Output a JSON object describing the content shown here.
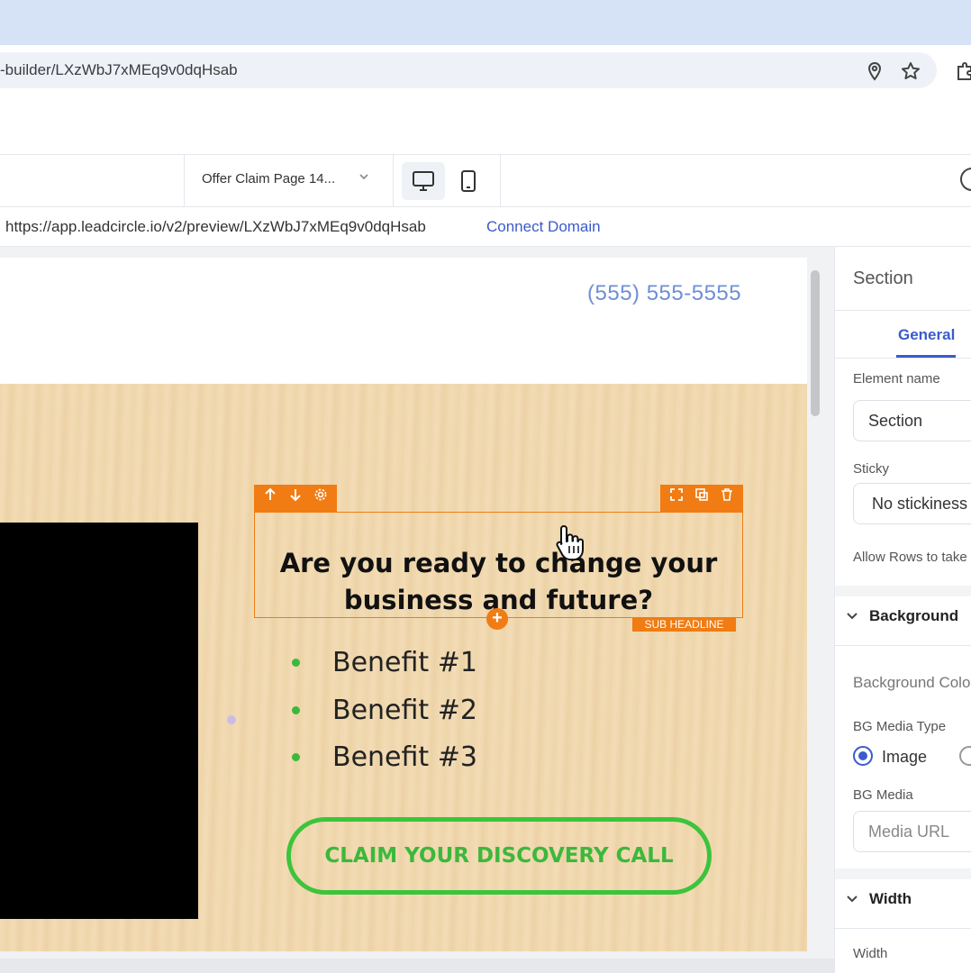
{
  "browser": {
    "url": "-builder/LXzWbJ7xMEq9v0dqHsab"
  },
  "toolbar": {
    "page_select": "Offer Claim Page 14...",
    "desktop_icon": "monitor-icon",
    "mobile_icon": "smartphone-icon"
  },
  "preview": {
    "url": "https://app.leadcircle.io/v2/preview/LXzWbJ7xMEq9v0dqHsab",
    "connect_domain": "Connect Domain"
  },
  "canvas": {
    "phone": "(555) 555-5555",
    "headline": "Are you ready to change your business and future?",
    "element_tag": "SUB HEADLINE",
    "benefits": [
      "Benefit #1",
      "Benefit #2",
      "Benefit #3"
    ],
    "cta": "CLAIM YOUR DISCOVERY CALL",
    "selection_color": "#f07c13",
    "cta_color": "#3cc43c"
  },
  "panel": {
    "title": "Section",
    "tab": "General",
    "element_name_label": "Element name",
    "element_name_value": "Section",
    "sticky_label": "Sticky",
    "sticky_value": "No stickiness",
    "allow_rows_label": "Allow Rows to take",
    "background_header": "Background",
    "bg_color_label": "Background Colo",
    "bg_media_type_label": "BG Media Type",
    "bg_media_type_option": "Image",
    "bg_media_label": "BG Media",
    "media_url_placeholder": "Media URL",
    "width_header": "Width",
    "width_label": "Width",
    "accent_color": "#3b5bcc"
  }
}
